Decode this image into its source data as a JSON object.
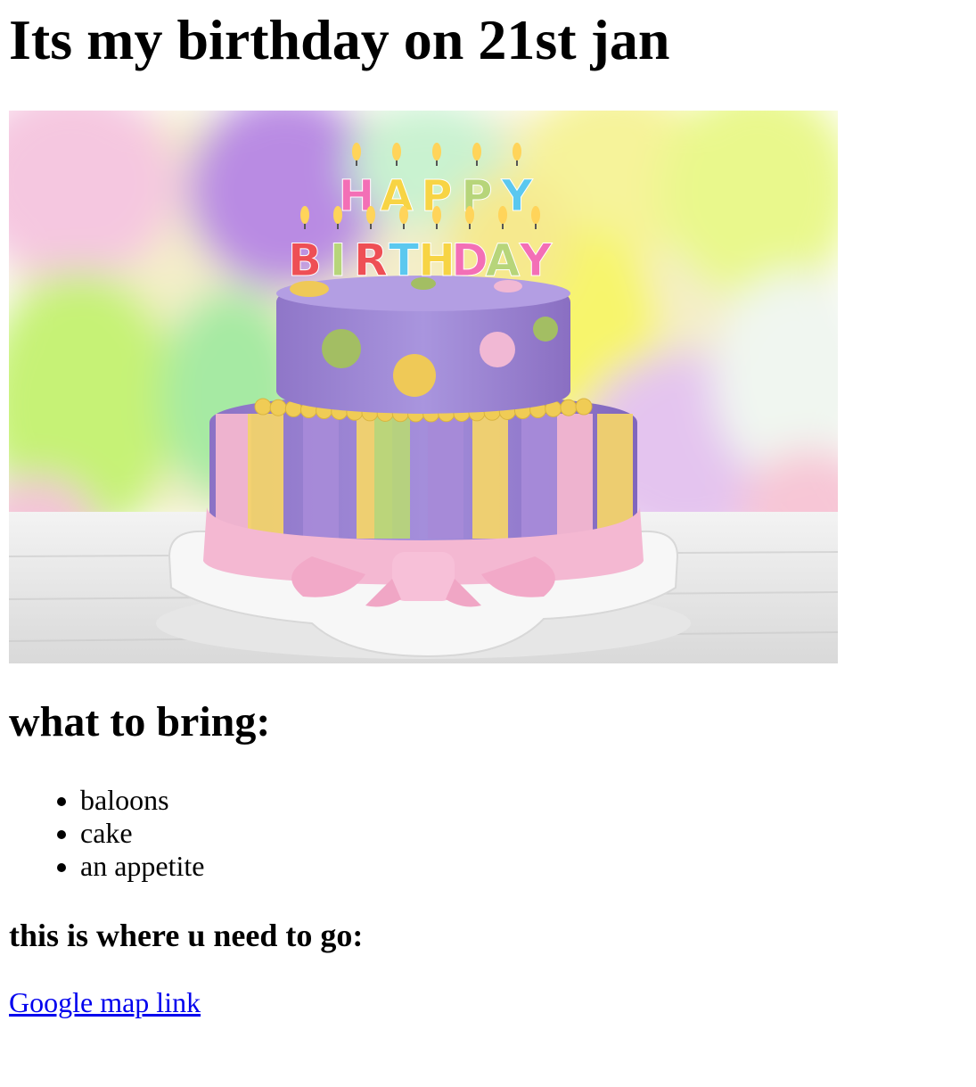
{
  "heading": "Its my birthday on 21st jan",
  "image": {
    "candle_letters_top": [
      "H",
      "A",
      "P",
      "P",
      "Y"
    ],
    "candle_letters_bottom": [
      "B",
      "I",
      "R",
      "T",
      "H",
      "D",
      "A",
      "Y"
    ],
    "colors": {
      "background_balloons": [
        "#c9a5ef",
        "#e8f88a",
        "#b8f2a0",
        "#f7c6dc",
        "#fff3a0"
      ],
      "cake_purple": "#a78ad8",
      "cake_pink": "#f3b6d0",
      "cake_yellow": "#f2d36b",
      "cake_green": "#b7d57a",
      "plate": "#f2f2f2"
    }
  },
  "bring_heading": "what to bring:",
  "bring_items": [
    "baloons",
    "cake",
    "an appetite"
  ],
  "where_heading": "this is where u need to go:",
  "map_link": {
    "label": "Google map link",
    "color": "#0000ee"
  }
}
